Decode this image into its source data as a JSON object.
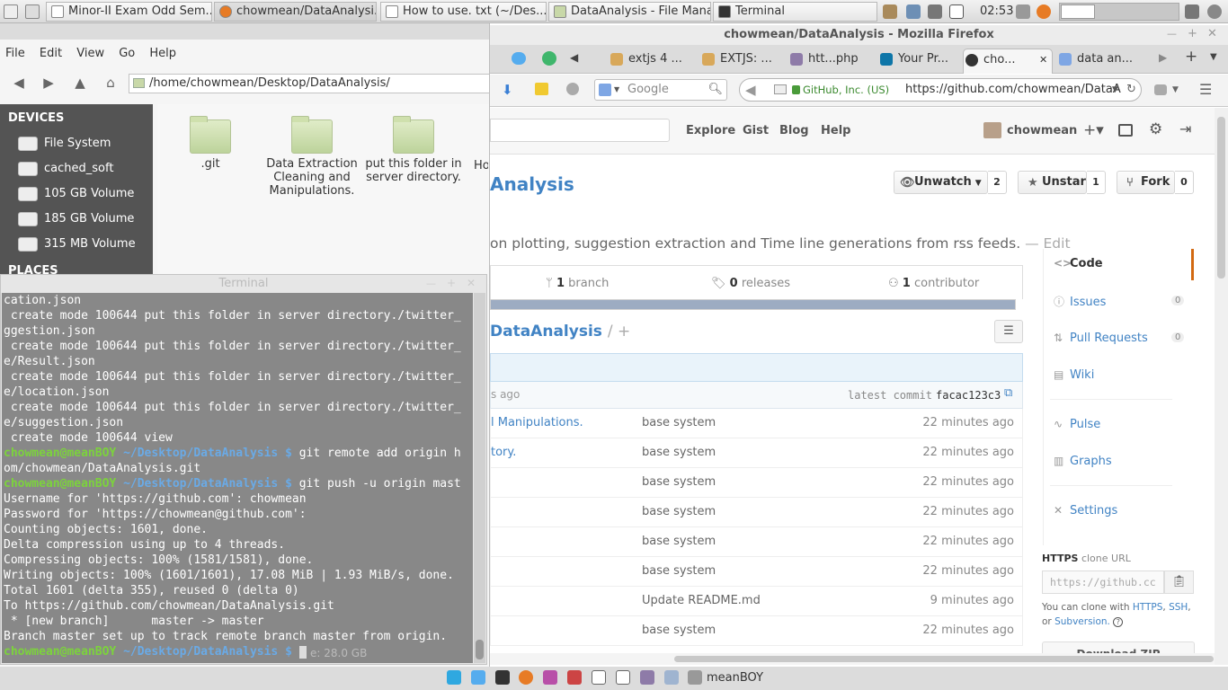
{
  "taskbar": {
    "tasks": [
      {
        "label": "Minor-II Exam Odd Sem..."
      },
      {
        "label": "chowmean/DataAnalysi..."
      },
      {
        "label": "How to use. txt (~/Des..."
      },
      {
        "label": "DataAnalysis - File Mana..."
      },
      {
        "label": "Terminal"
      }
    ],
    "clock": "02:53"
  },
  "file_manager": {
    "menu": [
      "File",
      "Edit",
      "View",
      "Go",
      "Help"
    ],
    "path": "/home/chowmean/Desktop/DataAnalysis/",
    "sidebar": {
      "devices_header": "DEVICES",
      "devices": [
        "File System",
        "cached_soft",
        "105 GB Volume",
        "185 GB Volume",
        "315 MB Volume"
      ],
      "places_header": "PLACES"
    },
    "folders": [
      {
        "name": ".git"
      },
      {
        "name": "Data Extraction\nCleaning and\nManipulations."
      },
      {
        "name": "put this folder in\nserver directory."
      },
      {
        "name": "Ho"
      }
    ]
  },
  "terminal": {
    "title": "Terminal",
    "lines": [
      {
        "t": "cation.json"
      },
      {
        "t": " create mode 100644 put this folder in server directory./twitter_"
      },
      {
        "t": "ggestion.json"
      },
      {
        "t": " create mode 100644 put this folder in server directory./twitter_"
      },
      {
        "t": "e/Result.json"
      },
      {
        "t": " create mode 100644 put this folder in server directory./twitter_"
      },
      {
        "t": "e/location.json"
      },
      {
        "t": " create mode 100644 put this folder in server directory./twitter_"
      },
      {
        "t": "e/suggestion.json"
      },
      {
        "t": " create mode 100644 view"
      },
      {
        "prompt": "chowmean@meanBOY",
        "dir": "~/Desktop/DataAnalysis $",
        "t": " git remote add origin h"
      },
      {
        "t": "om/chowmean/DataAnalysis.git"
      },
      {
        "prompt": "chowmean@meanBOY",
        "dir": "~/Desktop/DataAnalysis $",
        "t": " git push -u origin mast"
      },
      {
        "t": "Username for 'https://github.com': chowmean"
      },
      {
        "t": "Password for 'https://chowmean@github.com':"
      },
      {
        "t": "Counting objects: 1601, done."
      },
      {
        "t": "Delta compression using up to 4 threads."
      },
      {
        "t": "Compressing objects: 100% (1581/1581), done."
      },
      {
        "t": "Writing objects: 100% (1601/1601), 17.08 MiB | 1.93 MiB/s, done."
      },
      {
        "t": "Total 1601 (delta 355), reused 0 (delta 0)"
      },
      {
        "t": "To https://github.com/chowmean/DataAnalysis.git"
      },
      {
        "t": " * [new branch]      master -> master"
      },
      {
        "t": "Branch master set up to track remote branch master from origin."
      },
      {
        "prompt": "chowmean@meanBOY",
        "dir": "~/Desktop/DataAnalysis $",
        "t": " "
      }
    ]
  },
  "firefox": {
    "window_title": "chowmean/DataAnalysis - Mozilla Firefox",
    "tabs": [
      "extjs 4 ...",
      "EXTJS: ...",
      "htt...php",
      "Your Pr...",
      "cho...",
      "data an..."
    ],
    "search_placeholder": "Google",
    "identity": "GitHub, Inc. (US)",
    "url": "https://github.com/chowmean/DataA"
  },
  "github": {
    "nav": [
      "Explore",
      "Gist",
      "Blog",
      "Help"
    ],
    "user": "chowmean",
    "repo_title": "Analysis",
    "unwatch": {
      "label": "Unwatch",
      "count": "2"
    },
    "unstar": {
      "label": "Unstar",
      "count": "1"
    },
    "fork": {
      "label": "Fork",
      "count": "0"
    },
    "description": "on plotting, suggestion extraction and Time line generations from rss feeds.",
    "edit": "— Edit",
    "summary": {
      "branches_n": "1",
      "branches_l": "branch",
      "releases_n": "0",
      "releases_l": "releases",
      "contributors_n": "1",
      "contributors_l": "contributor"
    },
    "breadcrumb": "DataAnalysis",
    "breadcrumb_sep": "/ +",
    "commit_age": "s ago",
    "latest_commit_label": "latest commit",
    "latest_commit_hash": "facac123c3",
    "files": [
      {
        "name": "l Manipulations.",
        "message": "base system",
        "age": "22 minutes ago"
      },
      {
        "name": "tory.",
        "message": "base system",
        "age": "22 minutes ago"
      },
      {
        "name": "",
        "message": "base system",
        "age": "22 minutes ago"
      },
      {
        "name": "",
        "message": "base system",
        "age": "22 minutes ago"
      },
      {
        "name": "",
        "message": "base system",
        "age": "22 minutes ago"
      },
      {
        "name": "",
        "message": "base system",
        "age": "22 minutes ago"
      },
      {
        "name": "",
        "message": "Update README.md",
        "age": "9 minutes ago"
      },
      {
        "name": "",
        "message": "base system",
        "age": "22 minutes ago"
      }
    ],
    "side_nav": [
      {
        "label": "Code",
        "count": ""
      },
      {
        "label": "Issues",
        "count": "0"
      },
      {
        "label": "Pull Requests",
        "count": "0"
      },
      {
        "label": "Wiki",
        "count": ""
      },
      {
        "label": "Pulse",
        "count": ""
      },
      {
        "label": "Graphs",
        "count": ""
      },
      {
        "label": "Settings",
        "count": ""
      }
    ],
    "clone": {
      "heading": "HTTPS",
      "heading_suffix": "clone URL",
      "placeholder": "https://github.cc",
      "note_prefix": "You can clone with",
      "https": "HTTPS",
      "ssh": "SSH",
      "or": "or",
      "subversion": "Subversion."
    },
    "download": "Download ZIP"
  },
  "dock": {
    "user": "meanBOY",
    "free_space": "e: 28.0 GB"
  }
}
